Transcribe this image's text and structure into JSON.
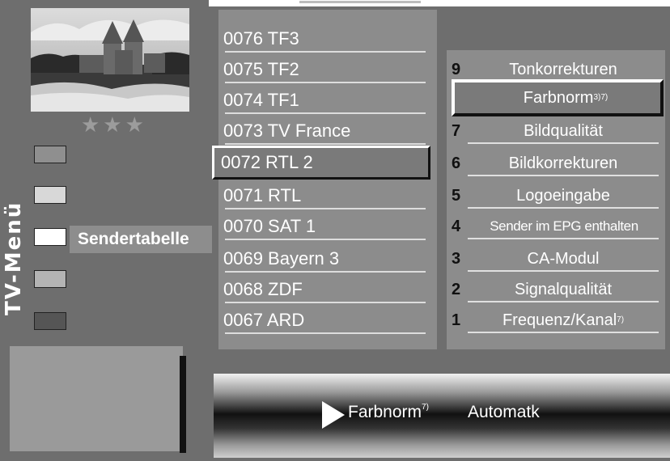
{
  "menu": {
    "title": "TV-Menü",
    "active_item": "Sendertabelle"
  },
  "preview": {
    "rating": "★★★"
  },
  "colors": {
    "background": "#6e6e6e",
    "panel": "#8c8c8c",
    "selection": "#7a7a7a"
  },
  "channels": [
    {
      "label": "0076 TF3"
    },
    {
      "label": "0075 TF2"
    },
    {
      "label": "0074 TF1"
    },
    {
      "label": "0073 TV France"
    },
    {
      "label": "0072 RTL 2",
      "selected": true
    },
    {
      "label": "0071 RTL"
    },
    {
      "label": "0070 SAT 1"
    },
    {
      "label": "0069 Bayern 3"
    },
    {
      "label": "0068 ZDF"
    },
    {
      "label": "0067 ARD"
    }
  ],
  "settings": [
    {
      "num": "9",
      "label": "Tonkorrekturen",
      "sup": ""
    },
    {
      "num": "",
      "label": "Farbnorm",
      "sup": "3)7)",
      "selected": true
    },
    {
      "num": "7",
      "label": "Bildqualität",
      "sup": ""
    },
    {
      "num": "6",
      "label": "Bildkorrekturen",
      "sup": ""
    },
    {
      "num": "5",
      "label": "Logoeingabe",
      "sup": ""
    },
    {
      "num": "4",
      "label": "Sender im EPG enthalten",
      "sup": ""
    },
    {
      "num": "3",
      "label": "CA-Modul",
      "sup": ""
    },
    {
      "num": "2",
      "label": "Signalqualität",
      "sup": ""
    },
    {
      "num": "1",
      "label": "Frequenz/Kanal",
      "sup": "7)"
    }
  ],
  "info": {
    "label": "Farbnorm",
    "label_sup": "7)",
    "value": "Automatk"
  }
}
